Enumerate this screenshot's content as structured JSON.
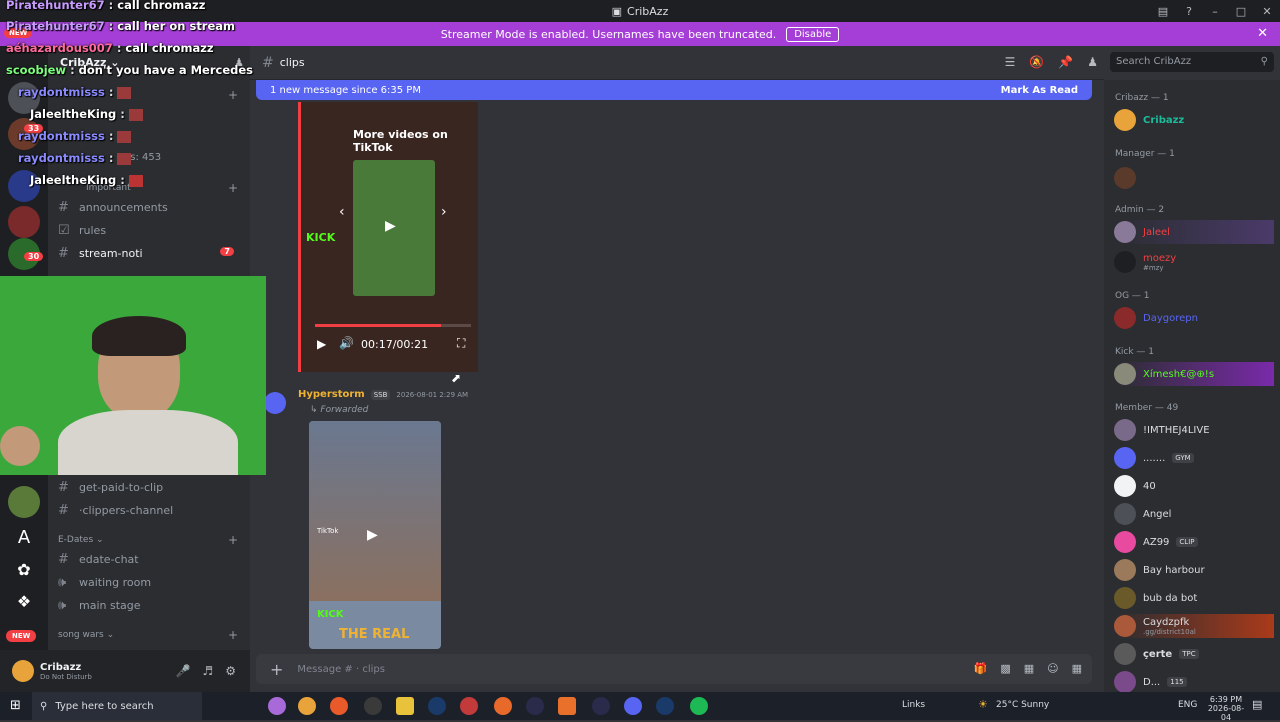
{
  "window": {
    "title": "CribAzz"
  },
  "banner": {
    "text": "Streamer Mode is enabled. Usernames have been truncated.",
    "button": "Disable"
  },
  "guilds": {
    "new_top": "NEW",
    "new_bottom": "NEW",
    "badges": [
      "33",
      "30"
    ]
  },
  "server": {
    "name": "CribAzz",
    "members_label": "ers: 453"
  },
  "channels": {
    "categories": {
      "important": "Important",
      "edates": "E-Dates",
      "songwars": "song wars"
    },
    "items": [
      "announcements",
      "rules",
      "stream-noti",
      "get-paid-to-clip",
      "·clippers-channel",
      "edate-chat",
      "waiting room",
      "main stage"
    ],
    "stream_noti_badge": "7"
  },
  "user": {
    "name": "Cribazz",
    "status": "Do Not Disturb"
  },
  "header": {
    "channel": "clips"
  },
  "newmsg": {
    "text": "1 new message since 6:35 PM",
    "action": "Mark As Read"
  },
  "search": {
    "placeholder": "Search CribAzz"
  },
  "chat": {
    "video1": {
      "overlay_title": "More videos on TikTok",
      "time": "00:17/00:21",
      "kick": "KICK"
    },
    "message": {
      "author": "Hyperstorm",
      "tag": "SSB",
      "timestamp": "2026-08-01 2:29 AM",
      "forwarded": "Forwarded"
    },
    "video2": {
      "watermark": "TikTok",
      "kick": "KICK",
      "title": "THE REAL"
    }
  },
  "compose": {
    "placeholder": "Message #",
    "channel": "clips"
  },
  "members": {
    "groups": [
      "Cribazz — 1",
      "Manager — 1",
      "Admin — 2",
      "OG — 1",
      "Kick — 1",
      "Member — 49"
    ],
    "people": [
      {
        "name": "Cribazz",
        "tag": "",
        "sub": ""
      },
      {
        "name": "Jaleel",
        "tag": "",
        "sub": ""
      },
      {
        "name": "moezy",
        "tag": "",
        "sub": "#mzy"
      },
      {
        "name": "Daygorepn",
        "tag": "",
        "sub": ""
      },
      {
        "name": "Xímesh€@⊕!s",
        "tag": "",
        "sub": ""
      },
      {
        "name": "!IMTHEJ4LIVE",
        "tag": "",
        "sub": ""
      },
      {
        "name": ".......",
        "tag": "GYM",
        "sub": ""
      },
      {
        "name": "40",
        "tag": "",
        "sub": ""
      },
      {
        "name": "Angel",
        "tag": "",
        "sub": ""
      },
      {
        "name": "AZ99",
        "tag": "CLIP",
        "sub": ""
      },
      {
        "name": "Bay harbour",
        "tag": "",
        "sub": ""
      },
      {
        "name": "bub da bot",
        "tag": "",
        "sub": ""
      },
      {
        "name": "Caydzpfk",
        "tag": "",
        "sub": ".gg/district10al"
      },
      {
        "name": "çerte",
        "tag": "TPC",
        "sub": ""
      },
      {
        "name": "D...",
        "tag": "115",
        "sub": ""
      }
    ]
  },
  "overlay_chat": [
    {
      "user": "Piratehunter67",
      "msg": "call chromazz",
      "color": "#c89cff"
    },
    {
      "user": "Piratehunter67",
      "msg": "call her on stream",
      "color": "#c89cff"
    },
    {
      "user": "aéhazardous007",
      "msg": "call chromazz",
      "color": "#ff6b9e"
    },
    {
      "user": "scoobjew",
      "msg": "don't you have a Mercedes",
      "color": "#7cff7c"
    },
    {
      "user": "raydontmisss",
      "msg": "",
      "color": "#8a8aff"
    },
    {
      "user": "JaleeltheKing",
      "msg": "",
      "color": "#ffffff"
    },
    {
      "user": "raydontmisss",
      "msg": "",
      "color": "#8a8aff"
    },
    {
      "user": "raydontmisss",
      "msg": "",
      "color": "#8a8aff"
    },
    {
      "user": "JaleeltheKing",
      "msg": "",
      "color": "#ffffff"
    }
  ],
  "taskbar": {
    "search": "Type here to search",
    "links": "Links",
    "weather": "25°C  Sunny",
    "lang": "ENG",
    "time": "6:39 PM",
    "date": "2026-08-04"
  }
}
